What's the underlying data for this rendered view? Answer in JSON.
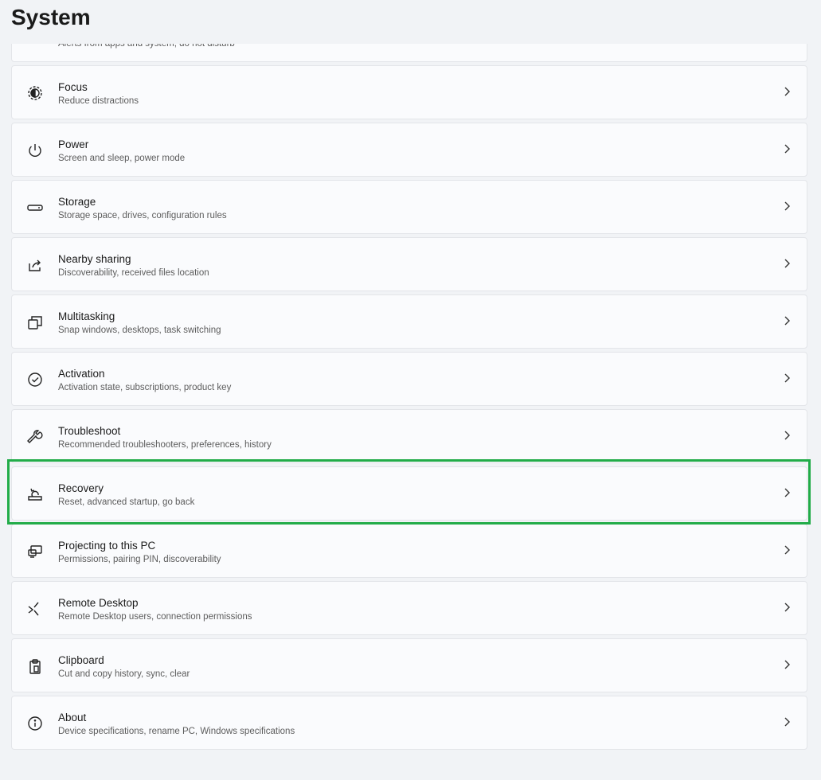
{
  "header": {
    "title": "System"
  },
  "items": [
    {
      "label": "",
      "sub": "Alerts from apps and system, do not disturb",
      "icon": "notifications-icon"
    },
    {
      "label": "Focus",
      "sub": "Reduce distractions",
      "icon": "focus-icon"
    },
    {
      "label": "Power",
      "sub": "Screen and sleep, power mode",
      "icon": "power-icon"
    },
    {
      "label": "Storage",
      "sub": "Storage space, drives, configuration rules",
      "icon": "storage-icon"
    },
    {
      "label": "Nearby sharing",
      "sub": "Discoverability, received files location",
      "icon": "share-icon"
    },
    {
      "label": "Multitasking",
      "sub": "Snap windows, desktops, task switching",
      "icon": "multitasking-icon"
    },
    {
      "label": "Activation",
      "sub": "Activation state, subscriptions, product key",
      "icon": "check-circle-icon"
    },
    {
      "label": "Troubleshoot",
      "sub": "Recommended troubleshooters, preferences, history",
      "icon": "wrench-icon"
    },
    {
      "label": "Recovery",
      "sub": "Reset, advanced startup, go back",
      "icon": "recovery-icon"
    },
    {
      "label": "Projecting to this PC",
      "sub": "Permissions, pairing PIN, discoverability",
      "icon": "projecting-icon"
    },
    {
      "label": "Remote Desktop",
      "sub": "Remote Desktop users, connection permissions",
      "icon": "remote-desktop-icon"
    },
    {
      "label": "Clipboard",
      "sub": "Cut and copy history, sync, clear",
      "icon": "clipboard-icon"
    },
    {
      "label": "About",
      "sub": "Device specifications, rename PC, Windows specifications",
      "icon": "info-icon"
    }
  ],
  "highlight": {
    "item": "Recovery",
    "color": "#22ac49"
  }
}
